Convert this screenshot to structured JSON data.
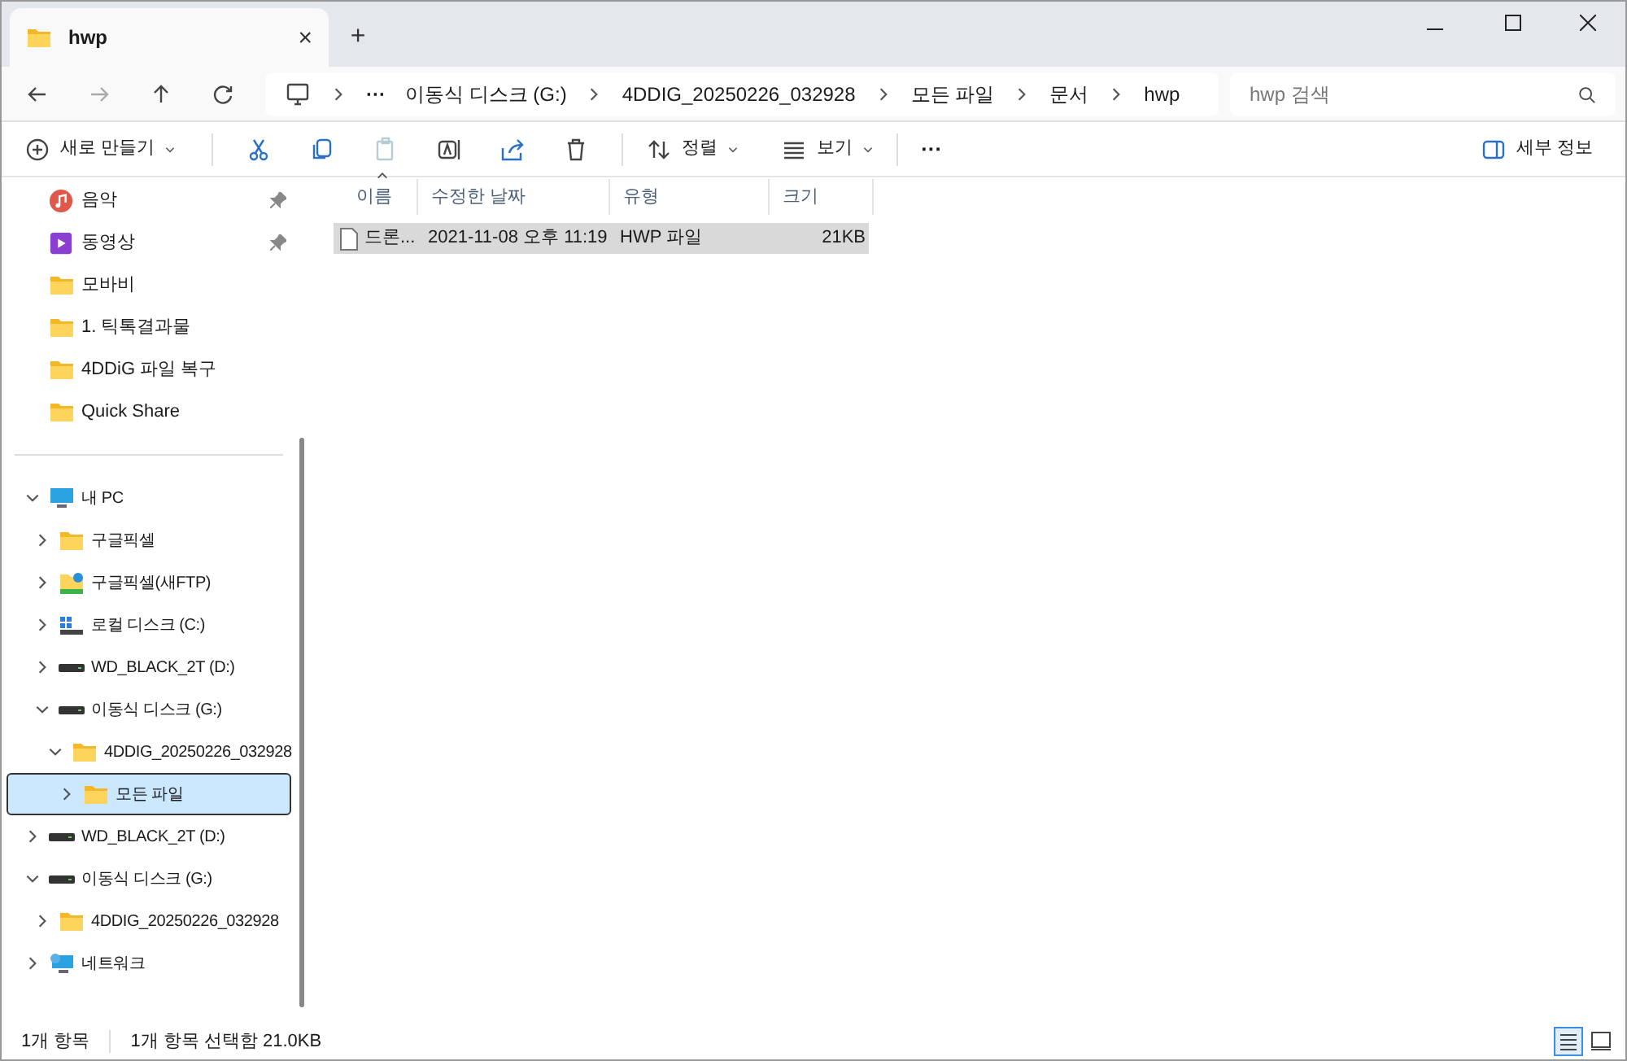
{
  "tab": {
    "title": "hwp",
    "close": "×",
    "new": "+"
  },
  "address": {
    "crumbs": [
      "이동식 디스크 (G:)",
      "4DDIG_20250226_032928",
      "모든 파일",
      "문서",
      "hwp"
    ],
    "more": "···"
  },
  "search": {
    "placeholder": "hwp 검색"
  },
  "toolbar": {
    "new": "새로 만들기",
    "sort": "정렬",
    "view": "보기",
    "more": "···",
    "details": "세부 정보"
  },
  "quick_access": [
    {
      "label": "음악",
      "kind": "music",
      "pinned": true
    },
    {
      "label": "동영상",
      "kind": "video",
      "pinned": true
    },
    {
      "label": "모바비",
      "kind": "folder",
      "pinned": false
    },
    {
      "label": "1. 틱톡결과물",
      "kind": "folder",
      "pinned": false
    },
    {
      "label": "4DDiG 파일 복구",
      "kind": "folder",
      "pinned": false
    },
    {
      "label": "Quick Share",
      "kind": "folder",
      "pinned": false
    }
  ],
  "tree": [
    {
      "label": "내 PC",
      "kind": "pc",
      "expanded": true,
      "selected": false,
      "children": [
        {
          "label": "구글픽셀",
          "kind": "folder",
          "expanded": false,
          "selected": false
        },
        {
          "label": "구글픽셀(새FTP)",
          "kind": "ftp",
          "expanded": false,
          "selected": false
        },
        {
          "label": "로컬 디스크 (C:)",
          "kind": "system",
          "expanded": false,
          "selected": false
        },
        {
          "label": "WD_BLACK_2T (D:)",
          "kind": "drive",
          "expanded": false,
          "selected": false
        },
        {
          "label": "이동식 디스크 (G:)",
          "kind": "drive",
          "expanded": true,
          "selected": false,
          "children": [
            {
              "label": "4DDIG_20250226_032928",
              "kind": "folder",
              "expanded": true,
              "selected": false,
              "children": [
                {
                  "label": "모든 파일",
                  "kind": "folder",
                  "expanded": false,
                  "selected": true
                }
              ]
            }
          ]
        }
      ]
    },
    {
      "label": "WD_BLACK_2T (D:)",
      "kind": "drive",
      "expanded": false,
      "selected": false
    },
    {
      "label": "이동식 디스크 (G:)",
      "kind": "drive",
      "expanded": true,
      "selected": false,
      "children": [
        {
          "label": "4DDIG_20250226_032928",
          "kind": "folder",
          "expanded": false,
          "selected": false
        }
      ]
    },
    {
      "label": "네트워크",
      "kind": "network",
      "expanded": false,
      "selected": false
    }
  ],
  "table": {
    "columns": [
      "이름",
      "수정한 날짜",
      "유형",
      "크기"
    ],
    "rows": [
      {
        "name": "드론...",
        "date": "2021-11-08 오후 11:19",
        "type": "HWP 파일",
        "size": "21KB",
        "selected": true
      }
    ]
  },
  "status_bar": {
    "count": "1개 항목",
    "selection": "1개 항목 선택함 21.0KB"
  }
}
